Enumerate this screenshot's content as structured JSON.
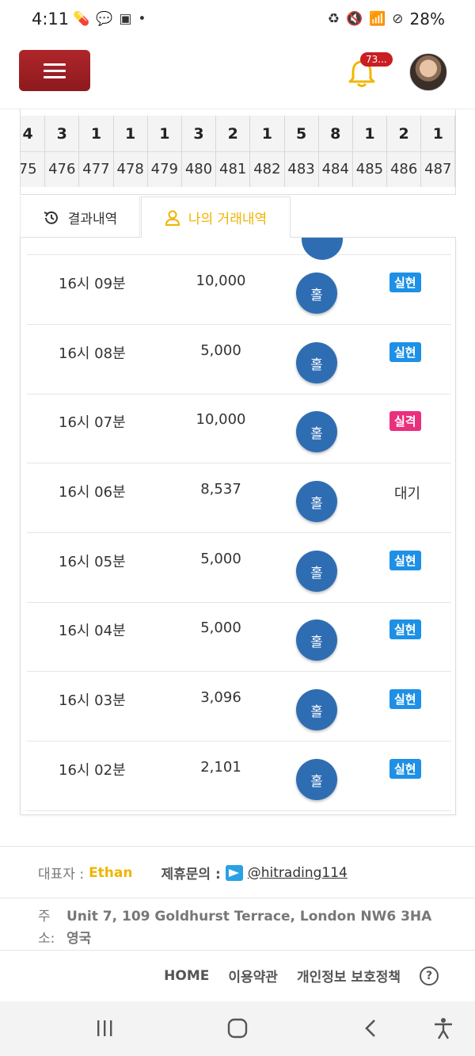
{
  "status_bar": {
    "time": "4:11",
    "left_icons": [
      "pill-icon",
      "talk-icon",
      "image-icon",
      "dot-icon"
    ],
    "battery": "28%"
  },
  "header": {
    "notification_count": "73..."
  },
  "results_strip": {
    "top_values": [
      "3",
      "1",
      "1",
      "1",
      "3",
      "2",
      "1",
      "5",
      "8",
      "1",
      "2",
      "1"
    ],
    "round_numbers": [
      "476",
      "477",
      "478",
      "479",
      "480",
      "481",
      "482",
      "483",
      "484",
      "485",
      "486",
      "487"
    ],
    "partial_left_top": "4",
    "partial_left_bottom": "75"
  },
  "tabs": {
    "results_label": "결과내역",
    "my_trades_label": "나의 거래내역"
  },
  "trades": [
    {
      "time": "16시 09분",
      "amount": "10,000",
      "pick": "홀",
      "status": "실현",
      "status_type": "win"
    },
    {
      "time": "16시 08분",
      "amount": "5,000",
      "pick": "홀",
      "status": "실현",
      "status_type": "win"
    },
    {
      "time": "16시 07분",
      "amount": "10,000",
      "pick": "홀",
      "status": "실격",
      "status_type": "lose"
    },
    {
      "time": "16시 06분",
      "amount": "8,537",
      "pick": "홀",
      "status": "대기",
      "status_type": "wait"
    },
    {
      "time": "16시 05분",
      "amount": "5,000",
      "pick": "홀",
      "status": "실현",
      "status_type": "win"
    },
    {
      "time": "16시 04분",
      "amount": "5,000",
      "pick": "홀",
      "status": "실현",
      "status_type": "win"
    },
    {
      "time": "16시 03분",
      "amount": "3,096",
      "pick": "홀",
      "status": "실현",
      "status_type": "win"
    },
    {
      "time": "16시 02분",
      "amount": "2,101",
      "pick": "홀",
      "status": "실현",
      "status_type": "win"
    }
  ],
  "footer": {
    "rep_label": "대표자 :",
    "rep_name": "Ethan",
    "contact_label": "제휴문의 :",
    "telegram_handle": "@hitrading114",
    "address_label": "주 소:",
    "address_line1": "Unit 7, 109 Goldhurst Terrace, London NW6 3HA",
    "address_line2": "영국",
    "links": [
      "HOME",
      "이용약관",
      "개인정보 보호정책"
    ],
    "help_glyph": "?"
  },
  "colors": {
    "brand_red": "#9e2024",
    "accent_yellow": "#f0b400",
    "chip_blue": "#2f6db3",
    "win_blue": "#1e90e6",
    "lose_pink": "#ea2f7d"
  }
}
